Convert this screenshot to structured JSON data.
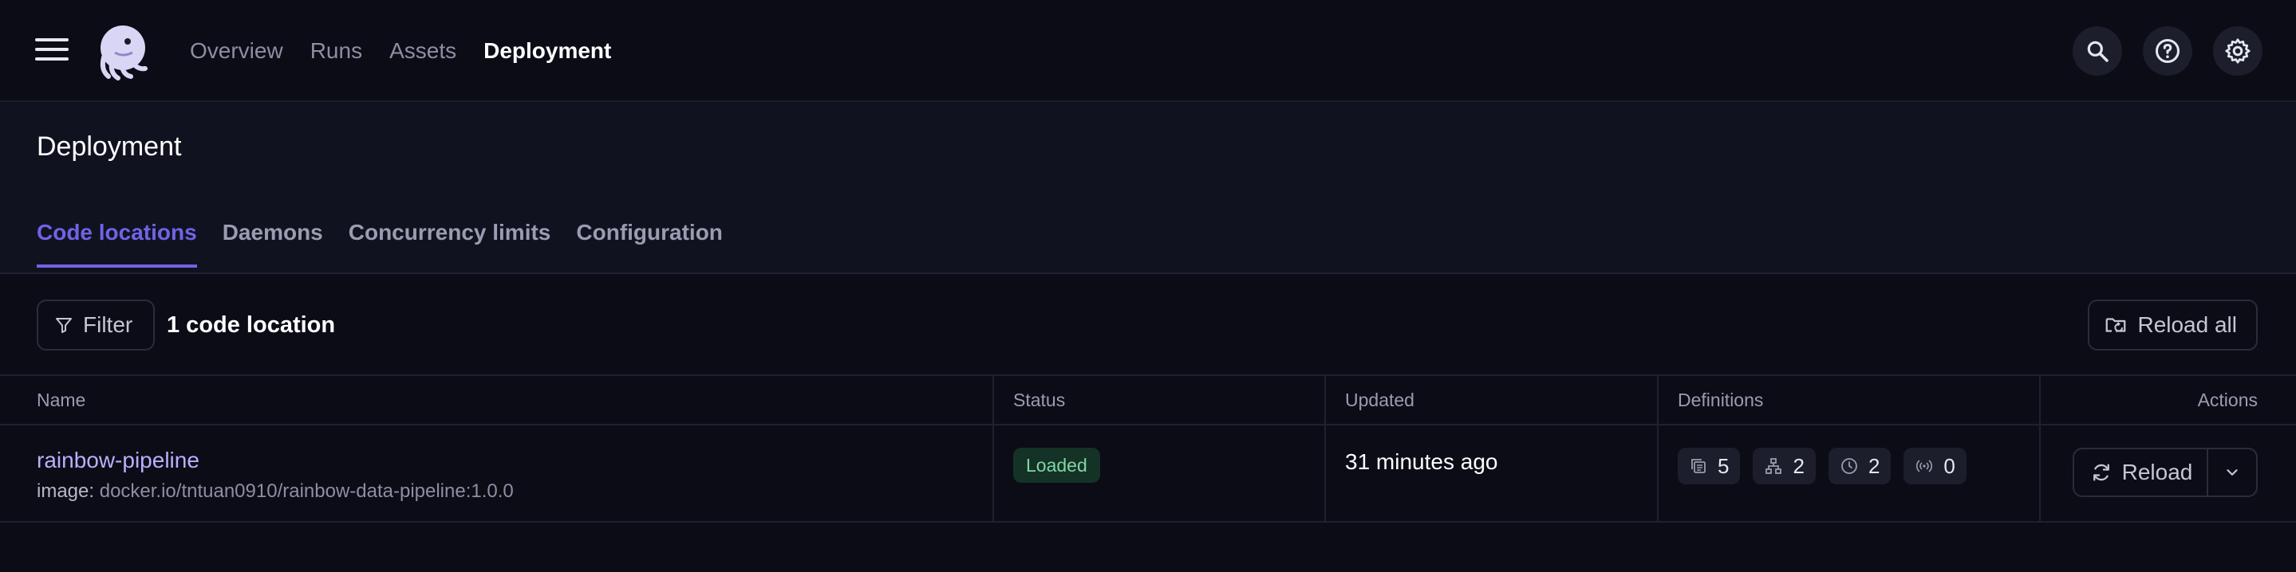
{
  "nav": {
    "items": [
      {
        "label": "Overview",
        "active": false
      },
      {
        "label": "Runs",
        "active": false
      },
      {
        "label": "Assets",
        "active": false
      },
      {
        "label": "Deployment",
        "active": true
      }
    ],
    "right_icons": [
      "search-icon",
      "help-icon",
      "settings-icon"
    ]
  },
  "page": {
    "title": "Deployment",
    "tabs": [
      {
        "label": "Code locations",
        "active": true
      },
      {
        "label": "Daemons",
        "active": false
      },
      {
        "label": "Concurrency limits",
        "active": false
      },
      {
        "label": "Configuration",
        "active": false
      }
    ]
  },
  "toolbar": {
    "filter_label": "Filter",
    "count_label": "1 code location",
    "reload_all_label": "Reload all"
  },
  "table": {
    "headers": {
      "name": "Name",
      "status": "Status",
      "updated": "Updated",
      "definitions": "Definitions",
      "actions": "Actions"
    },
    "rows": [
      {
        "name": "rainbow-pipeline",
        "image_key": "image:",
        "image_value": "docker.io/tntuan0910/rainbow-data-pipeline:1.0.0",
        "status": "Loaded",
        "updated": "31 minutes ago",
        "definitions": {
          "jobs": "5",
          "assets": "2",
          "schedules": "2",
          "sensors": "0"
        },
        "action_label": "Reload"
      }
    ]
  },
  "colors": {
    "accent": "#6f64e6",
    "link": "#b8b0ff",
    "status_loaded_bg": "#153227",
    "status_loaded_fg": "#7fd6a2"
  }
}
